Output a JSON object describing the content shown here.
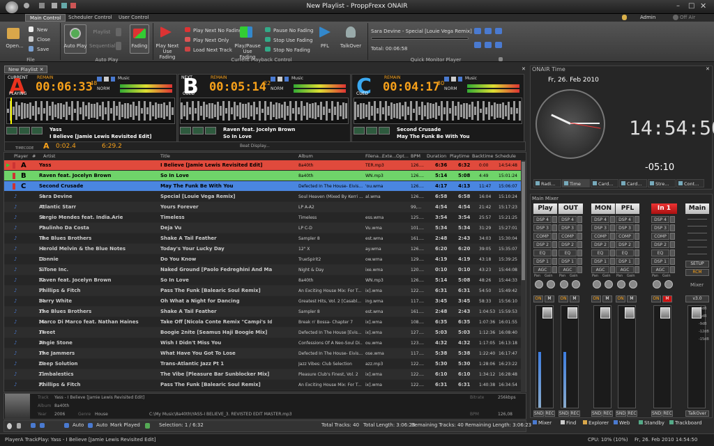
{
  "app": {
    "title": "New Playlist - ProppFrexx ONAIR",
    "user": "Admin",
    "offair": "Off Air"
  },
  "tabs": [
    "Main Control",
    "Scheduler Control",
    "User Control"
  ],
  "ribbon": {
    "file": {
      "open": "Open...",
      "new": "New",
      "close": "Close",
      "save": "Save",
      "group": "File"
    },
    "autoplay": {
      "auto": "Auto Play",
      "playlist": "Playlist",
      "sequential": "Sequential",
      "fading": "Fading",
      "group": "Auto Play"
    },
    "current": {
      "play_next_fading": "Play Next Use Fading",
      "play_next_no_fading": "Play Next No Fading",
      "play_next_only": "Play Next Only",
      "load_next": "Load Next Track",
      "play_pause": "Play/Pause Use Fading",
      "pause_no_fading": "Pause No Fading",
      "stop_use_fading": "Stop Use Fading",
      "stop_no_fading": "Stop No Fading",
      "pfl": "PFL",
      "talkover": "TalkOver",
      "group": "Current Playback Control"
    },
    "monitor": {
      "track": "Sara Devine - Special [Louie Vega Remix]",
      "total": "Total: 00:06:58",
      "group": "Quick Monitor Player"
    }
  },
  "playlist_tab": "New Playlist",
  "decks": [
    {
      "letter": "A",
      "status": "CURRENT",
      "state": "PLAYING",
      "label": "REMAIN",
      "time": "00:06:33",
      "ms": "48",
      "mode": "NORM",
      "music": "Music",
      "artist": "Yass",
      "title": "I Believe [Jamie Lewis Revisited Edit]",
      "color": "#e8321e"
    },
    {
      "letter": "B",
      "status": "NEXT",
      "state": "CUED",
      "label": "REMAIN",
      "time": "00:05:14",
      "ms": "22",
      "mode": "NORM",
      "music": "Music",
      "artist": "Raven feat. Jocelyn Brown",
      "title": "So In Love",
      "color": "#ffffff"
    },
    {
      "letter": "C",
      "status": "",
      "state": "CUED",
      "label": "REMAIN",
      "time": "00:04:17",
      "ms": "30",
      "mode": "NORM",
      "music": "Music",
      "artist": "Second Crusade",
      "title": "May The Funk Be With You",
      "color": "#3aa8f0"
    }
  ],
  "timecode": {
    "label": "TIMECODE",
    "deck": "A",
    "t1": "0:02.4",
    "t2": "6:29.2",
    "beat": "Beat Display..."
  },
  "columns": [
    "Player",
    "#",
    "Artist",
    "Title",
    "Album",
    "Filena...",
    "Exte...",
    "Opt...",
    "BPM",
    "Duration",
    "Playtime",
    "Backtime",
    "Schedule"
  ],
  "rows": [
    [
      "A",
      "",
      "Yass",
      "I Believe [Jamie Lewis Revisited Edit]",
      "8a40th",
      "TER.mp3",
      "126....",
      "6:36",
      "6:32",
      "0:00",
      "14:54:48"
    ],
    [
      "B",
      "",
      "Raven feat. Jocelyn Brown",
      "So In Love",
      "8a40th",
      "WN.mp3",
      "126....",
      "5:14",
      "5:08",
      "4:49",
      "15:01:24"
    ],
    [
      "C",
      "",
      "Second Crusade",
      "May The Funk Be With You",
      "Defected In The House- Eivis...",
      "'ou.wma",
      "126....",
      "4:17",
      "4:13",
      "11:47",
      "15:06:07"
    ],
    [
      "",
      "4",
      "Sara Devine",
      "Special [Louie Vega Remix]",
      "Soul Heaven (Mixed By Kerri ...",
      "al.wma",
      "126....",
      "6:58",
      "6:58",
      "16:04",
      "15:10:24"
    ],
    [
      "",
      "5",
      "Atlantic Starr",
      "Yours Forever",
      "LP A-A2",
      "",
      "99,...",
      "4:54",
      "4:54",
      "21:42",
      "15:17:23"
    ],
    [
      "",
      "6",
      "Sergio Mendes feat. India.Arie",
      "Timeless",
      "Timeless",
      "ess.wma",
      "125....",
      "3:54",
      "3:54",
      "25:57",
      "15:21:25"
    ],
    [
      "",
      "7",
      "Paulinho Da Costa",
      "Deja Vu",
      "LP C-D",
      "Vu.wma",
      "101....",
      "5:34",
      "5:34",
      "31:29",
      "15:27:01"
    ],
    [
      "",
      "8",
      "The Blues Brothers",
      "Shake A Tail Feather",
      "Sampler 8",
      "est.wma",
      "161....",
      "2:48",
      "2:43",
      "34:03",
      "15:30:04"
    ],
    [
      "",
      "9",
      "Herold Melvin & the Blue Notes",
      "Today's Your Lucky Day",
      "12\" X",
      "ay.wma",
      "126....",
      "6:20",
      "6:20",
      "39:05",
      "15:35:07"
    ],
    [
      "",
      "10",
      "Donnie",
      "Do You Know",
      "TrueSpirit2",
      "ow.wma",
      "129....",
      "4:19",
      "4:19",
      "43:18",
      "15:39:25"
    ],
    [
      "",
      "11",
      "S-Tone Inc.",
      "Naked Ground [Paolo Fedreghini And Marco Bianc...",
      "Night & Day",
      "ixe.wma",
      "120....",
      "0:10",
      "0:10",
      "43:23",
      "15:44:08"
    ],
    [
      "",
      "12",
      "Raven feat. Jocelyn Brown",
      "So In Love",
      "8a40th",
      "WN.mp3",
      "126....",
      "5:14",
      "5:08",
      "48:26",
      "15:44:33"
    ],
    [
      "",
      "13",
      "Phillips & Fitch",
      "Pass The Funk [Balearic Soul Remix]",
      "An Exciting House Mix: For T...",
      "ix].wma",
      "122....",
      "6:31",
      "6:31",
      "54:50",
      "15:49:42"
    ],
    [
      "",
      "14",
      "Barry White",
      "Oh What a Night for Dancing",
      "Greatest Hits, Vol. 2 [Casabl...",
      "ing.wma",
      "117....",
      "3:45",
      "3:45",
      "58:33",
      "15:56:10"
    ],
    [
      "",
      "15",
      "The Blues Brothers",
      "Shake A Tail Feather",
      "Sampler 8",
      "est.wma",
      "161....",
      "2:48",
      "2:43",
      "1:04:53",
      "15:59:53"
    ],
    [
      "",
      "16",
      "Marco Di Marco feat. Nathan Haines",
      "Take Off [Nicola Conte Remix \"Campi's Idea\" Versi...",
      "Break n' Bossa- Chapter 7",
      "ix].wma",
      "108....",
      "6:35",
      "6:35",
      "1:07:36",
      "16:01:55"
    ],
    [
      "",
      "17",
      "Tweet",
      "Boogie 2nite [Seamus Haji Boogie Mix]",
      "Defected In The House [Evis...",
      "ix].wma",
      "127....",
      "5:03",
      "5:03",
      "1:12:36",
      "16:08:40"
    ],
    [
      "",
      "18",
      "Angie Stone",
      "Wish I Didn't Miss You",
      "Confessions Of A Neo-Soul Di...",
      "ou.wma",
      "123....",
      "4:32",
      "4:32",
      "1:17:05",
      "16:13:18"
    ],
    [
      "",
      "19",
      "The Jammers",
      "What Have You Got To Lose",
      "Defected In The House- Eivis...",
      "ose.wma",
      "117....",
      "5:38",
      "5:38",
      "1:22:40",
      "16:17:47"
    ],
    [
      "",
      "20",
      "Deep Solution",
      "Trans-Atlantic Jazz Pt 1",
      "Jazz Vibes: Club Selection",
      "azz.mp3",
      "122....",
      "5:30",
      "5:30",
      "1:28:06",
      "16:23:22"
    ],
    [
      "",
      "21",
      "Timbalestics",
      "The Vibe [Pleasure Bar Sunblocker Mix]",
      "Pleasure Club's Finest, Vol. 2",
      "ix].wma",
      "122....",
      "6:10",
      "6:10",
      "1:34:12",
      "16:28:48"
    ],
    [
      "",
      "22",
      "Phillips & Fitch",
      "Pass The Funk [Balearic Soul Remix]",
      "An Exciting House Mix: For T...",
      "ix].wma",
      "122....",
      "6:31",
      "6:31",
      "1:40:38",
      "16:34:54"
    ]
  ],
  "info": {
    "track": "Yass - I Believe [Jamie Lewis Revisited Edit]",
    "album": "8a40th",
    "year": "2006",
    "genre": "House",
    "path": "C:\\My Music\\8a40th\\YASS-I BELIEVE_3. REVISTED EDIT MASTER.mp3",
    "kbps": "256kbps",
    "bpm": "126,08",
    "labels": {
      "title": "Track",
      "album": "Album",
      "year": "Year",
      "genre": "Genre",
      "bitrate": "Bitrate",
      "bpm": "BPM"
    }
  },
  "toolbar": {
    "auto1": "Auto",
    "auto2": "Auto",
    "mark": "Mark Played",
    "selection": "Selection: 1 / 6:32",
    "total_tracks": "Total Tracks: 40",
    "total_length": "Total Length: 3:06:23",
    "remaining_tracks": "Remaining Tracks: 40",
    "remaining_length": "Remaining Length: 3:06:23"
  },
  "time_panel": {
    "header": "ONAIR Time",
    "date": "Fr, 26. Feb 2010",
    "digital": "14:54:50",
    "countdown": "-05:10",
    "tabs": [
      "Radi...",
      "Time",
      "Card...",
      "Card...",
      "Stre...",
      "Cont..."
    ]
  },
  "mixer": {
    "header": "Main Mixer",
    "channels": [
      "Play",
      "OUT",
      "MON",
      "PFL",
      "In 1",
      "Main"
    ],
    "fx": [
      "DSP 4",
      "DSP 3",
      "COMP",
      "DSP 2",
      "EQ",
      "DSP 1",
      "AGC"
    ],
    "pan": "Pan",
    "gain": "Gain",
    "on": "ON",
    "m": "M",
    "snd": "SND",
    "rec": "REC",
    "setup": "SETUP",
    "rcm": "RCM",
    "mixer_label": "Mixer",
    "version": "v3.0",
    "talkover": "TalkOver",
    "db": [
      "-3dB",
      "-6dB",
      "-9dB",
      "-12dB",
      "-15dB"
    ]
  },
  "bottom_tabs": [
    "Mixer",
    "Find",
    "Explorer",
    "Web",
    "Standby",
    "Trackboard"
  ],
  "status": {
    "player": "PlayerA TrackPlay: Yass - I Believe [Jamie Lewis Revisited Edit]",
    "cpu": "CPU: 10% (10%)",
    "datetime": "Fr, 26. Feb 2010 14:54:50"
  }
}
